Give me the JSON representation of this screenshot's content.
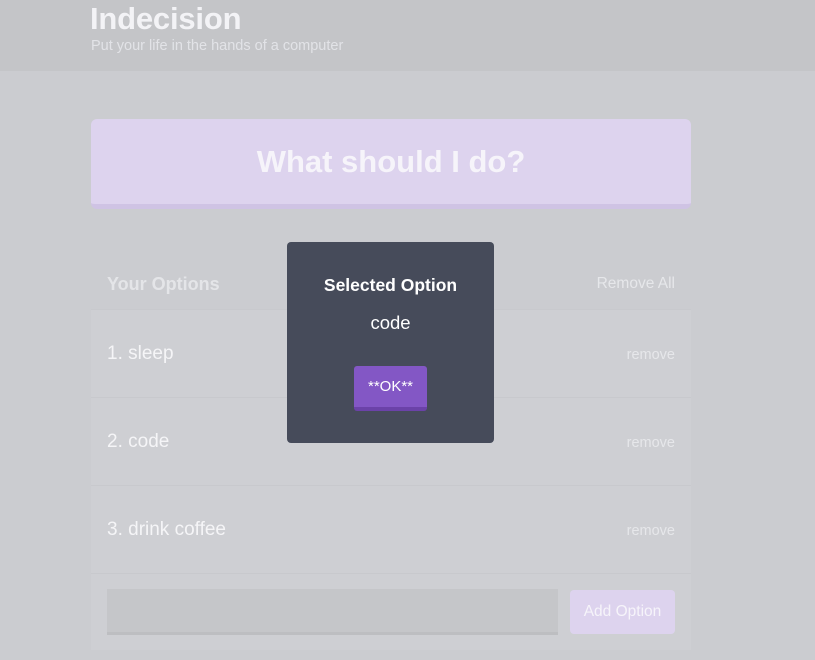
{
  "header": {
    "title": "Indecision",
    "subtitle": "Put your life in the hands of a computer"
  },
  "action": {
    "label": "What should I do?"
  },
  "options": {
    "title": "Your Options",
    "remove_all_label": "Remove All",
    "remove_label": "remove",
    "items": [
      {
        "text": "1. sleep"
      },
      {
        "text": "2. code"
      },
      {
        "text": "3. drink coffee"
      }
    ],
    "add_input": {
      "value": "",
      "placeholder": ""
    },
    "add_button_label": "Add Option"
  },
  "modal": {
    "title": "Selected Option",
    "value": "code",
    "ok_label": "**OK**"
  },
  "colors": {
    "accent_purple": "#8357c5",
    "modal_background": "#464b5a",
    "light_purple": "#ddd3ee"
  }
}
